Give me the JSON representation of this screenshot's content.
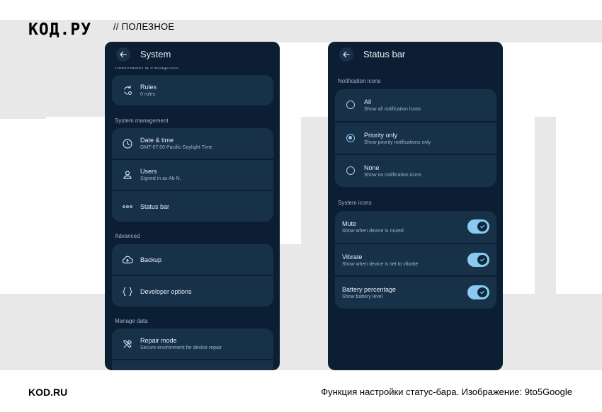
{
  "header": {
    "logo": "КОД.РУ",
    "tagline": "// ПОЛЕЗНОЕ"
  },
  "footer": {
    "brand": "KOD.RU",
    "caption": "Функция настройки статус-бара. Изображение: 9to5Google"
  },
  "left": {
    "title": "System",
    "sections": {
      "automation": "Automation & intelligence",
      "system_management": "System management",
      "advanced": "Advanced",
      "manage_data": "Manage data"
    },
    "items": {
      "rules": {
        "title": "Rules",
        "sub": "0 rules"
      },
      "datetime": {
        "title": "Date & time",
        "sub": "GMT-07:00 Pacific Daylight Time"
      },
      "users": {
        "title": "Users",
        "sub": "Signed in as Ab N."
      },
      "statusbar": {
        "title": "Status bar"
      },
      "backup": {
        "title": "Backup"
      },
      "developer": {
        "title": "Developer options"
      },
      "repair": {
        "title": "Repair mode",
        "sub": "Secure environment for device repair"
      }
    }
  },
  "right": {
    "title": "Status bar",
    "sections": {
      "notification": "Notification icons",
      "system": "System icons"
    },
    "notification_options": [
      {
        "title": "All",
        "sub": "Show all notification icons",
        "selected": false
      },
      {
        "title": "Priority only",
        "sub": "Show priority notifications only",
        "selected": true
      },
      {
        "title": "None",
        "sub": "Show no notification icons",
        "selected": false
      }
    ],
    "toggles": [
      {
        "title": "Mute",
        "sub": "Show when device is muted",
        "on": true
      },
      {
        "title": "Vibrate",
        "sub": "Show when device is set to vibrate",
        "on": true
      },
      {
        "title": "Battery percentage",
        "sub": "Show battery level",
        "on": true
      }
    ]
  },
  "colors": {
    "phone_bg": "#0b1e33",
    "card_bg": "#173149",
    "accent": "#8cc9ef"
  }
}
